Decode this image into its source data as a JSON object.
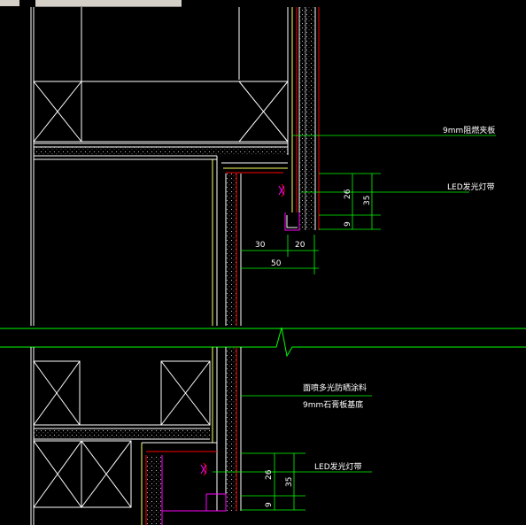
{
  "labels": {
    "board_9mm_fireproof": "9mm阻燃夹板",
    "led_strip_top": "LED发光灯带",
    "paint_line1": "面喷多光防晒涂料",
    "paint_line2": "9mm石膏板基底",
    "led_strip_bottom": "LED发光灯带"
  },
  "dimensions": {
    "top_26": "26",
    "top_9": "9",
    "top_35": "35",
    "horiz_30": "30",
    "horiz_20": "20",
    "horiz_50": "50",
    "bottom_26": "26",
    "bottom_9": "9",
    "bottom_35": "35"
  },
  "colors": {
    "background": "#000000",
    "outline": "#ffffff",
    "dimension": "#00ff00",
    "accent_red": "#ff0000",
    "accent_magenta": "#ff00ff",
    "accent_yellow": "#ffff66"
  }
}
